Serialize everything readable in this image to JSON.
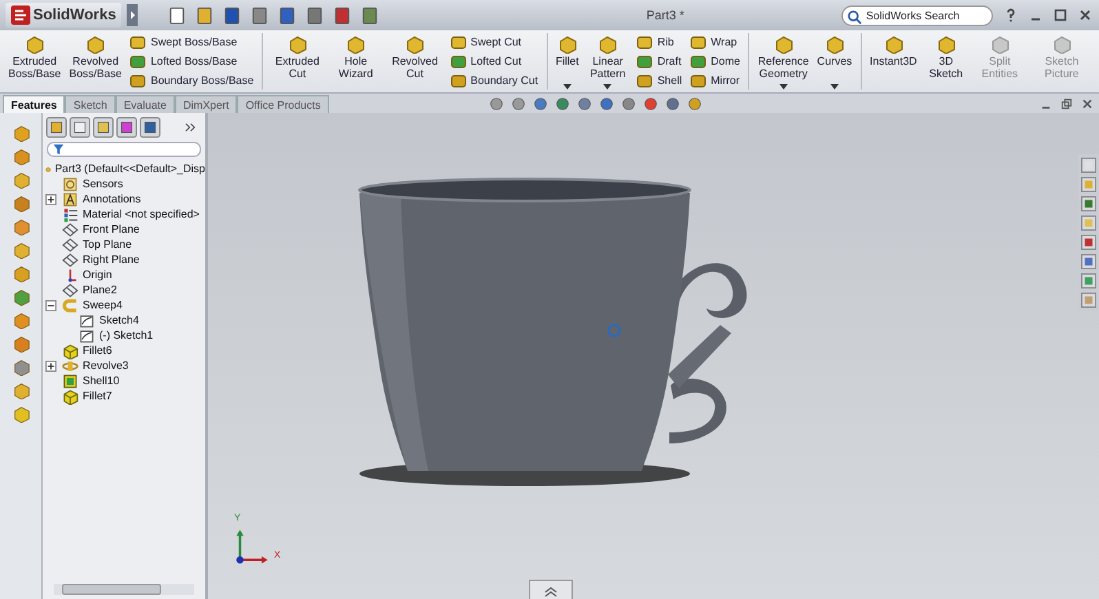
{
  "window": {
    "app_name": "SolidWorks",
    "title": "Part3 *"
  },
  "search": {
    "placeholder": "SolidWorks Search"
  },
  "ribbon": {
    "groups": [
      {
        "items": [
          {
            "kind": "large",
            "label": "Extruded Boss/Base",
            "dropdown": false,
            "disabled": false
          },
          {
            "kind": "large",
            "label": "Revolved Boss/Base",
            "dropdown": false,
            "disabled": false
          },
          {
            "kind": "stack",
            "entries": [
              "Swept Boss/Base",
              "Lofted Boss/Base",
              "Boundary Boss/Base"
            ]
          }
        ]
      },
      {
        "items": [
          {
            "kind": "large",
            "label": "Extruded Cut",
            "dropdown": false,
            "disabled": false
          },
          {
            "kind": "large",
            "label": "Hole Wizard",
            "dropdown": false,
            "disabled": false
          },
          {
            "kind": "large",
            "label": "Revolved Cut",
            "dropdown": false,
            "disabled": false
          },
          {
            "kind": "stack",
            "entries": [
              "Swept Cut",
              "Lofted Cut",
              "Boundary Cut"
            ]
          }
        ]
      },
      {
        "items": [
          {
            "kind": "large",
            "label": "Fillet",
            "dropdown": true,
            "disabled": false
          },
          {
            "kind": "large",
            "label": "Linear Pattern",
            "dropdown": true,
            "disabled": false
          },
          {
            "kind": "stack",
            "entries": [
              "Rib",
              "Draft",
              "Shell"
            ]
          },
          {
            "kind": "stack",
            "entries": [
              "Wrap",
              "Dome",
              "Mirror"
            ]
          }
        ]
      },
      {
        "items": [
          {
            "kind": "large",
            "label": "Reference Geometry",
            "dropdown": true,
            "disabled": false
          },
          {
            "kind": "large",
            "label": "Curves",
            "dropdown": true,
            "disabled": false
          }
        ]
      },
      {
        "items": [
          {
            "kind": "large",
            "label": "Instant3D",
            "dropdown": false,
            "disabled": false
          },
          {
            "kind": "large",
            "label": "3D Sketch",
            "dropdown": false,
            "disabled": false
          },
          {
            "kind": "large",
            "label": "Split Entities",
            "dropdown": false,
            "disabled": true
          },
          {
            "kind": "large",
            "label": "Sketch Picture",
            "dropdown": false,
            "disabled": true
          }
        ]
      }
    ]
  },
  "tabs": [
    {
      "label": "Features",
      "selected": true
    },
    {
      "label": "Sketch",
      "selected": false
    },
    {
      "label": "Evaluate",
      "selected": false
    },
    {
      "label": "DimXpert",
      "selected": false
    },
    {
      "label": "Office Products",
      "selected": false
    }
  ],
  "feature_tree": {
    "root": {
      "label": "Part3  (Default<<Default>_Disp",
      "kind": "part",
      "children": [
        {
          "label": "Sensors",
          "kind": "sensor"
        },
        {
          "label": "Annotations",
          "kind": "annotation",
          "expanded": false
        },
        {
          "label": "Material <not specified>",
          "kind": "material"
        },
        {
          "label": "Front Plane",
          "kind": "plane"
        },
        {
          "label": "Top Plane",
          "kind": "plane"
        },
        {
          "label": "Right Plane",
          "kind": "plane"
        },
        {
          "label": "Origin",
          "kind": "origin"
        },
        {
          "label": "Plane2",
          "kind": "plane"
        },
        {
          "label": "Sweep4",
          "kind": "sweep",
          "expanded": true,
          "children": [
            {
              "label": "Sketch4",
              "kind": "sketch"
            },
            {
              "label": "(-) Sketch1",
              "kind": "sketch"
            }
          ]
        },
        {
          "label": "Fillet6",
          "kind": "fillet"
        },
        {
          "label": "Revolve3",
          "kind": "revolve",
          "expanded": false
        },
        {
          "label": "Shell10",
          "kind": "shell"
        },
        {
          "label": "Fillet7",
          "kind": "fillet"
        }
      ]
    }
  },
  "triad": {
    "y_label": "Y",
    "x_label": "X"
  }
}
